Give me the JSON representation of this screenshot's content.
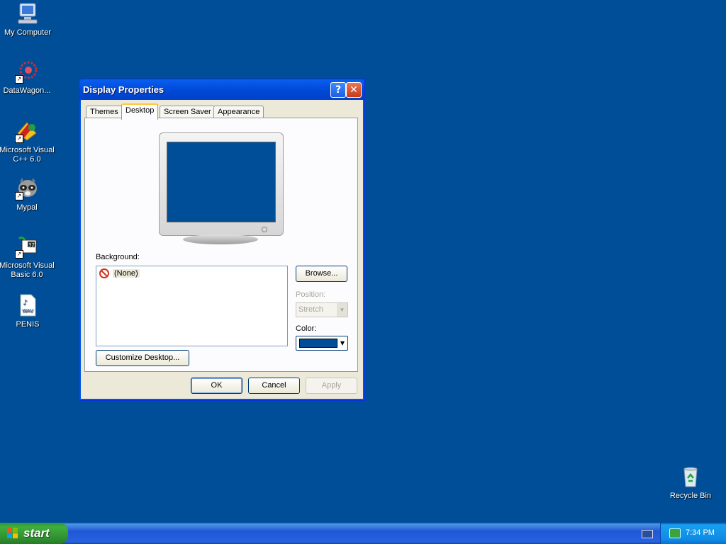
{
  "desktop": {
    "icons": [
      {
        "label": "My Computer"
      },
      {
        "label": "DataWagon..."
      },
      {
        "label": "Microsoft Visual C++ 6.0"
      },
      {
        "label": "Mypal"
      },
      {
        "label": "Microsoft Visual Basic 6.0"
      },
      {
        "label": "PENIS"
      },
      {
        "label": "Recycle Bin"
      }
    ],
    "background_color": "#004e98"
  },
  "dialog": {
    "title": "Display Properties",
    "help_label": "?",
    "close_label": "✕",
    "tabs": [
      {
        "label": "Themes"
      },
      {
        "label": "Desktop"
      },
      {
        "label": "Screen Saver"
      },
      {
        "label": "Appearance"
      }
    ],
    "active_tab": "Desktop",
    "background_label": "Background:",
    "background_items": [
      {
        "label": "(None)"
      }
    ],
    "browse_label": "Browse...",
    "position_label": "Position:",
    "position_value": "Stretch",
    "color_label": "Color:",
    "color_value": "#004e98",
    "customize_label": "Customize Desktop...",
    "ok_label": "OK",
    "cancel_label": "Cancel",
    "apply_label": "Apply",
    "wav_badge": "WAV"
  },
  "taskbar": {
    "start_label": "start",
    "clock": "7:34 PM"
  }
}
